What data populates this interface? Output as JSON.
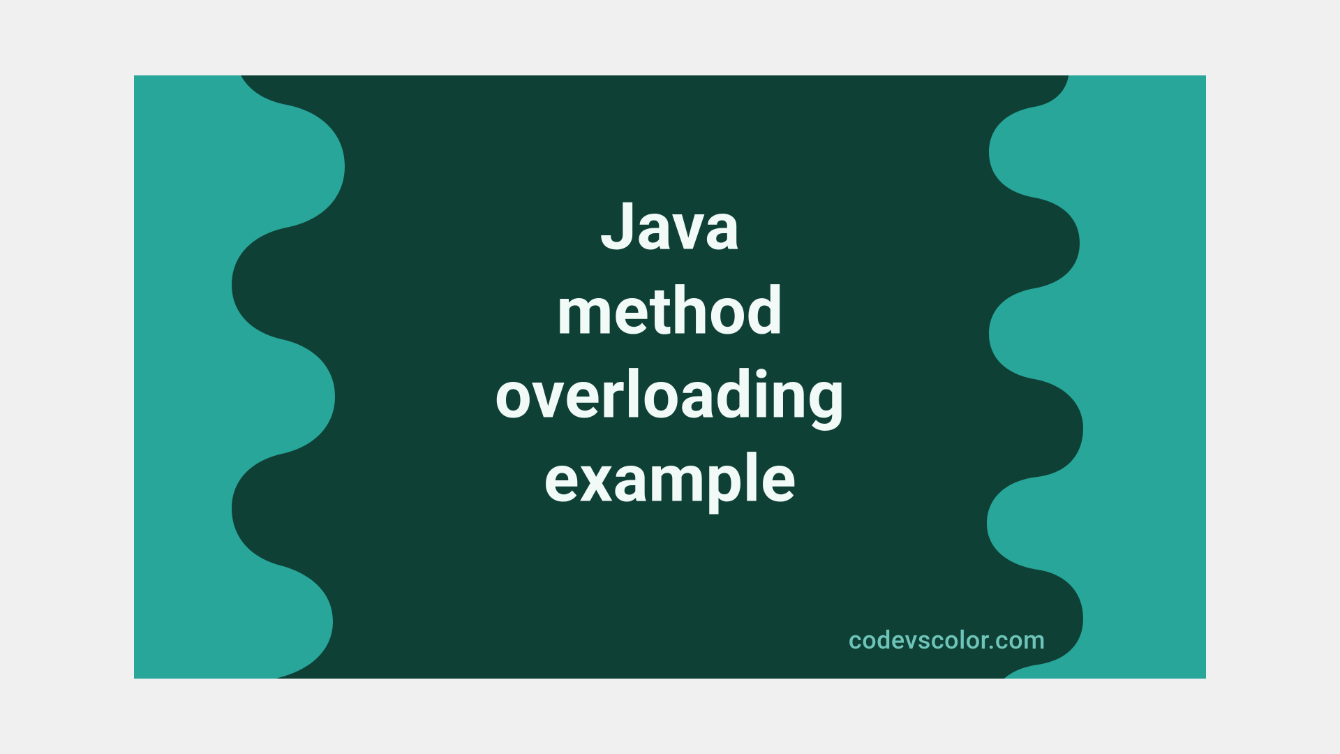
{
  "banner": {
    "title": "Java\nmethod\noverloading\nexample",
    "watermark": "codevscolor.com",
    "colors": {
      "background": "#28a69a",
      "blob": "#0f4036",
      "titleText": "#f1faf7",
      "watermarkText": "#6ec4b8"
    }
  }
}
